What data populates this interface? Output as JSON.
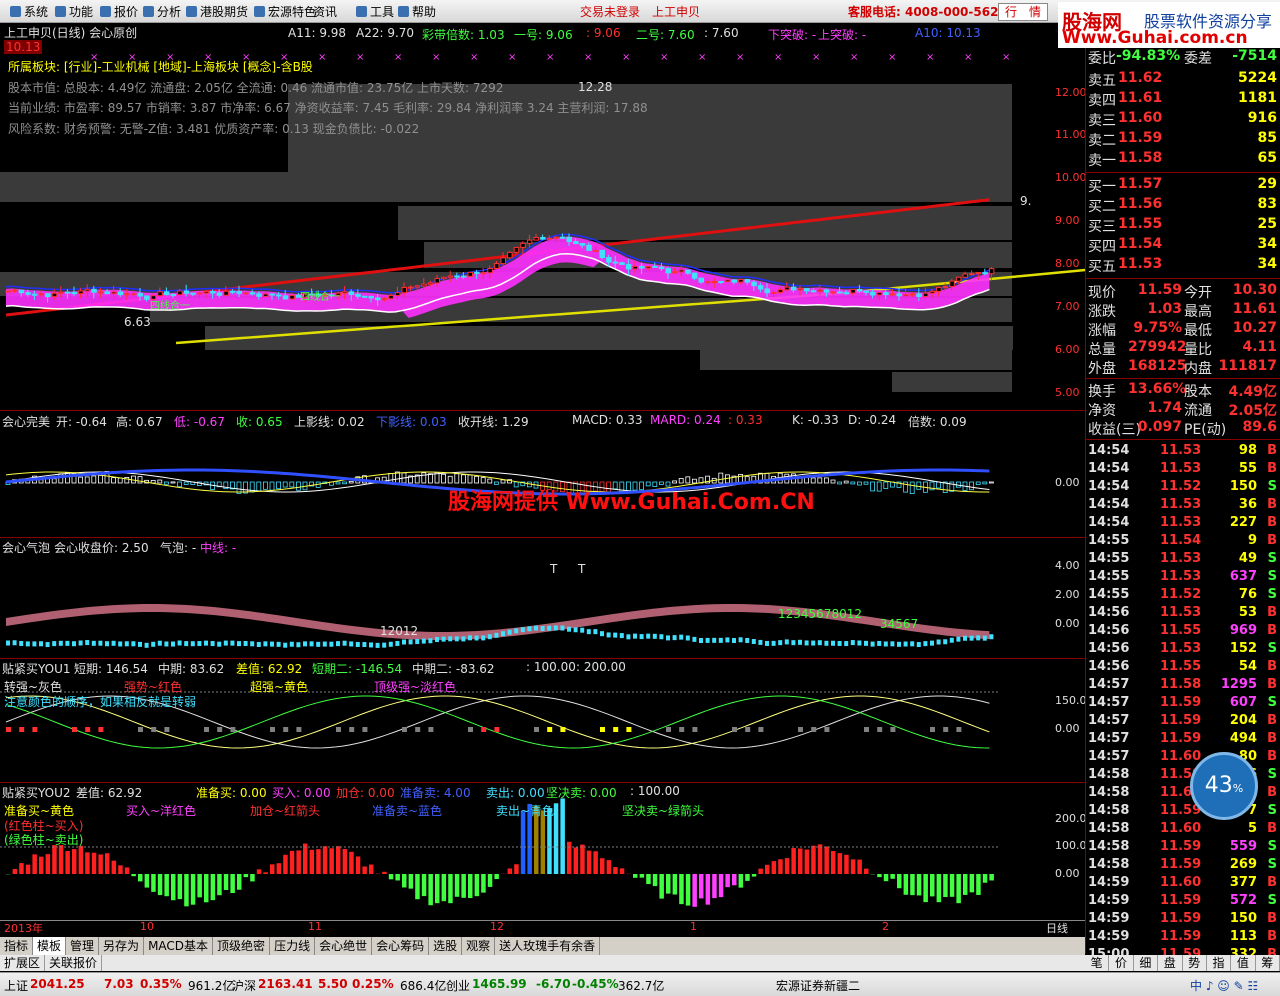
{
  "menu": {
    "items": [
      "系统",
      "功能",
      "报价",
      "分析",
      "港股期货",
      "宏源特色",
      "资讯",
      "工具",
      "帮助"
    ],
    "trade_not_logged": "交易未登录",
    "stock_name": "上工申贝",
    "hotline": "客服电话: 4008-000-562",
    "mode_tabs": [
      "行",
      "情"
    ]
  },
  "logo": {
    "line1": "股海网",
    "line2": "股票软件资源分享",
    "line3": "Www.Guhai.com.cn"
  },
  "main_panel": {
    "title": "上工申贝(日线) 会心原创",
    "price_tag": "10.13",
    "a11": "A11: 9.98",
    "a22": "A22: 9.70",
    "caidai": "彩带倍数: 1.03",
    "yihao": "一号: 9.06",
    "yihao2": ": 9.06",
    "erhao": "二号: 7.60",
    "erhao2": ": 7.60",
    "xiatupo": "下突破: -",
    "shangtupo": "上突破: -",
    "a10": "A10: 10.13",
    "info1": "所属板块: [行业]-工业机械 [地域]-上海板块 [概念]-含B股",
    "info2": "股本市值: 总股本: 4.49亿 流通盘: 2.05亿 全流通: 0.46 流通市值: 23.75亿 上市天数: 7292",
    "info3": "当前业绩: 市盈率: 89.57 市销率: 3.87 市净率: 6.67 净资收益率: 7.45 毛利率: 29.84 净利润率 3.24 主营利润: 17.88",
    "info4": "风险系数: 财务预警: 无警-Z值: 3.481 优质资产率: 0.13 现金负债比: -0.022",
    "high_label": "12.28",
    "low_label": "6.63",
    "last_label": "9.",
    "cross_labels": [
      "四线合一",
      "四线合一"
    ],
    "y_ticks": [
      "12.00",
      "11.00",
      "10.00",
      "9.00",
      "8.00",
      "7.00",
      "6.00",
      "5.00"
    ]
  },
  "panel2": {
    "title": "会心完美",
    "kai": "开: -0.64",
    "gao": "高: 0.67",
    "di": "低: -0.67",
    "shou": "收: 0.65",
    "shangying": "上影线: 0.02",
    "xiaying": "下影线: 0.03",
    "shoukai": "收开线: 1.29",
    "macd": "MACD: 0.33",
    "mard": "MARD: 0.24",
    "extra": ": 0.33",
    "k": "K: -0.33",
    "d": "D: -0.24",
    "beishu": "倍数: 0.09",
    "watermark": "股海网提供 Www.Guhai.Com.CN",
    "y_ticks": [
      "0.00"
    ]
  },
  "panel3": {
    "title": "会心气泡",
    "shoupan": "会心收盘价: 2.50",
    "qipao": "气泡: -",
    "zhongxian": "中线: -",
    "seq1": "12012",
    "seq2": "12345678012",
    "seq3": "34567",
    "t_marks": [
      "T",
      "T"
    ],
    "y_ticks": [
      "4.00",
      "2.00",
      "0.00"
    ]
  },
  "panel4": {
    "title": "贴紧买YOU1",
    "duanqi": "短期: 146.54",
    "zhongqi": "中期: 83.62",
    "chazhi": "差值: 62.92",
    "duanqi2": "短期二: -146.54",
    "zhongqi2": "中期二: -83.62",
    "v100": ": 100.00",
    "v200": ": 200.00",
    "leg1": "转强~灰色",
    "leg2": "强势~红色",
    "leg3": "超强~黄色",
    "leg4": "顶级强~淡红色",
    "note": "注意颜色的顺序，如果相反就是转弱",
    "y_ticks": [
      "150.00",
      "0.00"
    ]
  },
  "panel5": {
    "title": "贴紧买YOU2",
    "chazhi": "差值: 62.92",
    "zhunbeimai": "准备买: 0.00",
    "mairu": "买入: 0.00",
    "jiacang": "加仓: 0.00",
    "zhunbeimai2": "准备卖: 4.00",
    "maichu": "卖出: 0.00",
    "jianjue": "坚决卖: 0.00",
    "v100": ": 100.00",
    "leg1": "准备买~黄色",
    "leg2": "买入~洋红色",
    "leg3": "加仓~红箭头",
    "leg4": "准备卖~蓝色",
    "leg5": "卖出~青色",
    "leg6": "坚决卖~绿箭头",
    "leg7": "(红色柱~买入)",
    "leg8": "(绿色柱~卖出)",
    "y_ticks": [
      "200.00",
      "100.00",
      "0.00"
    ]
  },
  "x_axis": {
    "labels": [
      "2013年",
      "10",
      "11",
      "12",
      "1",
      "2"
    ],
    "period": "日线"
  },
  "quote": {
    "weibi": "委比",
    "weibi_val": "-94.83%",
    "weicha": "委差",
    "weicha_val": "-7514",
    "asks": [
      {
        "label": "卖五",
        "price": "11.62",
        "vol": "5224"
      },
      {
        "label": "卖四",
        "price": "11.61",
        "vol": "1181"
      },
      {
        "label": "卖三",
        "price": "11.60",
        "vol": "916"
      },
      {
        "label": "卖二",
        "price": "11.59",
        "vol": "85"
      },
      {
        "label": "卖一",
        "price": "11.58",
        "vol": "65"
      }
    ],
    "bids": [
      {
        "label": "买一",
        "price": "11.57",
        "vol": "29"
      },
      {
        "label": "买二",
        "price": "11.56",
        "vol": "83"
      },
      {
        "label": "买三",
        "price": "11.55",
        "vol": "25"
      },
      {
        "label": "买四",
        "price": "11.54",
        "vol": "34"
      },
      {
        "label": "买五",
        "price": "11.53",
        "vol": "34"
      }
    ],
    "stats": [
      {
        "l1": "现价",
        "v1": "11.59",
        "l2": "今开",
        "v2": "10.30"
      },
      {
        "l1": "涨跌",
        "v1": "1.03",
        "l2": "最高",
        "v2": "11.61"
      },
      {
        "l1": "涨幅",
        "v1": "9.75%",
        "l2": "最低",
        "v2": "10.27"
      },
      {
        "l1": "总量",
        "v1": "279942",
        "l2": "量比",
        "v2": "4.11"
      },
      {
        "l1": "外盘",
        "v1": "168125",
        "l2": "内盘",
        "v2": "111817"
      }
    ],
    "stats2": [
      {
        "l1": "换手",
        "v1": "13.66%",
        "l2": "股本",
        "v2": "4.49亿"
      },
      {
        "l1": "净资",
        "v1": "1.74",
        "l2": "流通",
        "v2": "2.05亿"
      },
      {
        "l1": "收益(三)",
        "v1": "0.097",
        "l2": "PE(动)",
        "v2": "89.6"
      }
    ]
  },
  "ticks": [
    {
      "t": "14:54",
      "p": "11.53",
      "v": "98",
      "d": "B"
    },
    {
      "t": "14:54",
      "p": "11.53",
      "v": "55",
      "d": "B"
    },
    {
      "t": "14:54",
      "p": "11.52",
      "v": "150",
      "d": "S"
    },
    {
      "t": "14:54",
      "p": "11.53",
      "v": "36",
      "d": "B"
    },
    {
      "t": "14:54",
      "p": "11.53",
      "v": "227",
      "d": "B"
    },
    {
      "t": "14:55",
      "p": "11.54",
      "v": "9",
      "d": "B"
    },
    {
      "t": "14:55",
      "p": "11.53",
      "v": "49",
      "d": "S"
    },
    {
      "t": "14:55",
      "p": "11.53",
      "v": "637",
      "d": "S"
    },
    {
      "t": "14:55",
      "p": "11.52",
      "v": "76",
      "d": "S"
    },
    {
      "t": "14:56",
      "p": "11.53",
      "v": "53",
      "d": "B"
    },
    {
      "t": "14:56",
      "p": "11.55",
      "v": "969",
      "d": "B"
    },
    {
      "t": "14:56",
      "p": "11.53",
      "v": "152",
      "d": "S"
    },
    {
      "t": "14:56",
      "p": "11.55",
      "v": "54",
      "d": "B"
    },
    {
      "t": "14:57",
      "p": "11.58",
      "v": "1295",
      "d": "B"
    },
    {
      "t": "14:57",
      "p": "11.59",
      "v": "607",
      "d": "S"
    },
    {
      "t": "14:57",
      "p": "11.59",
      "v": "204",
      "d": "B"
    },
    {
      "t": "14:57",
      "p": "11.59",
      "v": "494",
      "d": "B"
    },
    {
      "t": "14:57",
      "p": "11.60",
      "v": "80",
      "d": "B"
    },
    {
      "t": "14:58",
      "p": "11.59",
      "v": "56",
      "d": "S"
    },
    {
      "t": "14:58",
      "p": "11.60",
      "v": "76",
      "d": "B"
    },
    {
      "t": "14:58",
      "p": "11.59",
      "v": "7",
      "d": "S"
    },
    {
      "t": "14:58",
      "p": "11.60",
      "v": "5",
      "d": "B"
    },
    {
      "t": "14:58",
      "p": "11.59",
      "v": "559",
      "d": "S"
    },
    {
      "t": "14:58",
      "p": "11.59",
      "v": "269",
      "d": "S"
    },
    {
      "t": "14:59",
      "p": "11.60",
      "v": "377",
      "d": "B"
    },
    {
      "t": "14:59",
      "p": "11.59",
      "v": "572",
      "d": "S"
    },
    {
      "t": "14:59",
      "p": "11.59",
      "v": "150",
      "d": "B"
    },
    {
      "t": "14:59",
      "p": "11.59",
      "v": "113",
      "d": "B"
    },
    {
      "t": "15:00",
      "p": "11.59",
      "v": "332",
      "d": "B"
    }
  ],
  "bottom_tabs": [
    "指标",
    "模板",
    "管理",
    "另存为",
    "MACD基本",
    "顶级绝密",
    "压力线",
    "会心绝世",
    "会心筹码",
    "选股",
    "观察",
    "送人玫瑰手有余香"
  ],
  "ext_bar": [
    "扩展区",
    "关联报价"
  ],
  "rp_tabs": [
    "笔",
    "价",
    "细",
    "盘",
    "势",
    "指",
    "值",
    "筹"
  ],
  "status": {
    "sh_name": "上证",
    "sh_val": "2041.25",
    "sh_chg": "7.03",
    "sh_pct": "0.35%",
    "sh_amt": "961.2亿",
    "sz_name": "沪深",
    "sz_val": "2163.41",
    "sz_chg": "5.50",
    "sz_pct": "0.25%",
    "sz_amt": "686.4亿",
    "cy_name": "创业",
    "cy_val": "1465.99",
    "cy_chg": "-6.70",
    "cy_pct": "-0.45%",
    "cy_amt": "362.7亿",
    "broker": "宏源证券新疆二"
  },
  "gauge": {
    "value": "43",
    "unit": "%"
  },
  "colors": {
    "up": "#ff3030",
    "down": "#40ff40",
    "bg": "#000000",
    "grid": "#880000"
  }
}
